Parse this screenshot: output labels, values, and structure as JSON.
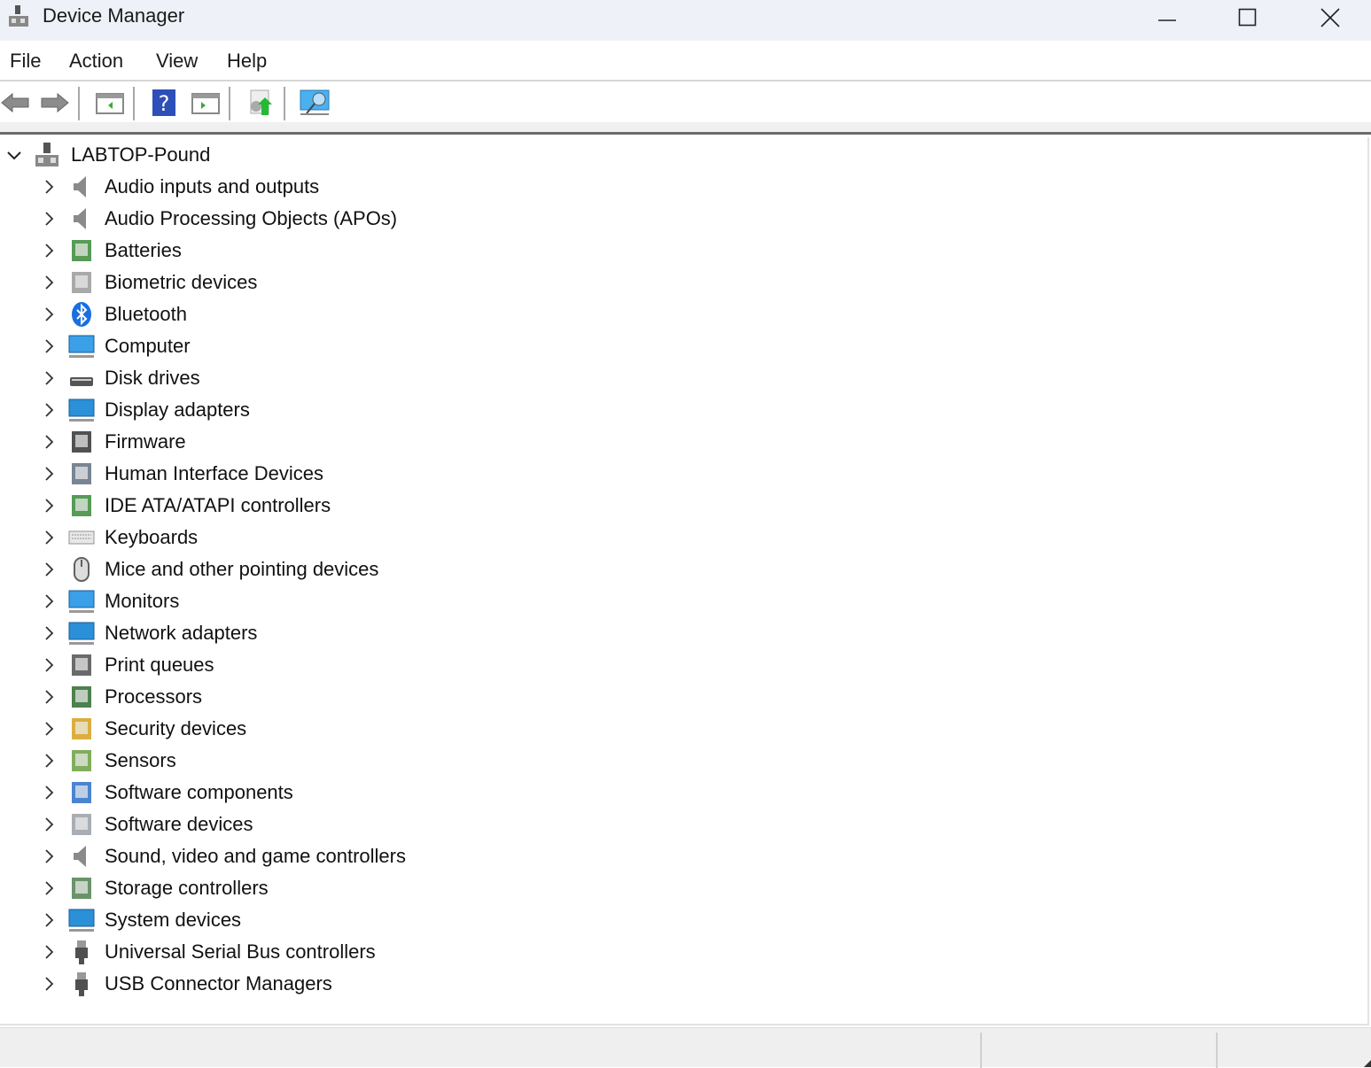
{
  "window": {
    "title": "Device Manager"
  },
  "menu": [
    "File",
    "Action",
    "View",
    "Help"
  ],
  "toolbar": [
    "back-icon",
    "forward-icon",
    "show-hide-console-tree-icon",
    "help-icon",
    "show-action-pane-icon",
    "update-driver-icon",
    "scan-hardware-icon"
  ],
  "tree": {
    "root": {
      "label": "LABTOP-Pound",
      "icon": "computer-root-icon",
      "expanded": true
    },
    "items": [
      {
        "label": "Audio inputs and outputs",
        "icon": "speaker-icon",
        "color": "#8a8a8a"
      },
      {
        "label": "Audio Processing Objects (APOs)",
        "icon": "speaker-icon",
        "color": "#8a8a8a"
      },
      {
        "label": "Batteries",
        "icon": "battery-icon",
        "color": "#3a8a3a"
      },
      {
        "label": "Biometric devices",
        "icon": "fingerprint-icon",
        "color": "#9a9a9a"
      },
      {
        "label": "Bluetooth",
        "icon": "bluetooth-icon",
        "color": "#1a6fe0"
      },
      {
        "label": "Computer",
        "icon": "computer-icon",
        "color": "#3aa0e8"
      },
      {
        "label": "Disk drives",
        "icon": "disk-drive-icon",
        "color": "#555555"
      },
      {
        "label": "Display adapters",
        "icon": "display-adapter-icon",
        "color": "#2a90d8"
      },
      {
        "label": "Firmware",
        "icon": "firmware-icon",
        "color": "#333333"
      },
      {
        "label": "Human Interface Devices",
        "icon": "hid-icon",
        "color": "#607080"
      },
      {
        "label": "IDE ATA/ATAPI controllers",
        "icon": "ide-controller-icon",
        "color": "#3a8a3a"
      },
      {
        "label": "Keyboards",
        "icon": "keyboard-icon",
        "color": "#909090"
      },
      {
        "label": "Mice and other pointing devices",
        "icon": "mouse-icon",
        "color": "#606060"
      },
      {
        "label": "Monitors",
        "icon": "monitor-icon",
        "color": "#3aa0e8"
      },
      {
        "label": "Network adapters",
        "icon": "network-adapter-icon",
        "color": "#2a90d8"
      },
      {
        "label": "Print queues",
        "icon": "printer-icon",
        "color": "#505050"
      },
      {
        "label": "Processors",
        "icon": "processor-icon",
        "color": "#2e6b2e"
      },
      {
        "label": "Security devices",
        "icon": "security-key-icon",
        "color": "#d4a020"
      },
      {
        "label": "Sensors",
        "icon": "sensor-icon",
        "color": "#6aa040"
      },
      {
        "label": "Software components",
        "icon": "software-component-icon",
        "color": "#2a70c8"
      },
      {
        "label": "Software devices",
        "icon": "software-device-icon",
        "color": "#9aa0a8"
      },
      {
        "label": "Sound, video and game controllers",
        "icon": "speaker-icon",
        "color": "#8a8a8a"
      },
      {
        "label": "Storage controllers",
        "icon": "storage-controller-icon",
        "color": "#508050"
      },
      {
        "label": "System devices",
        "icon": "system-device-icon",
        "color": "#2a90d8"
      },
      {
        "label": "Universal Serial Bus controllers",
        "icon": "usb-icon",
        "color": "#505050"
      },
      {
        "label": "USB Connector Managers",
        "icon": "usb-icon",
        "color": "#505050"
      }
    ]
  }
}
